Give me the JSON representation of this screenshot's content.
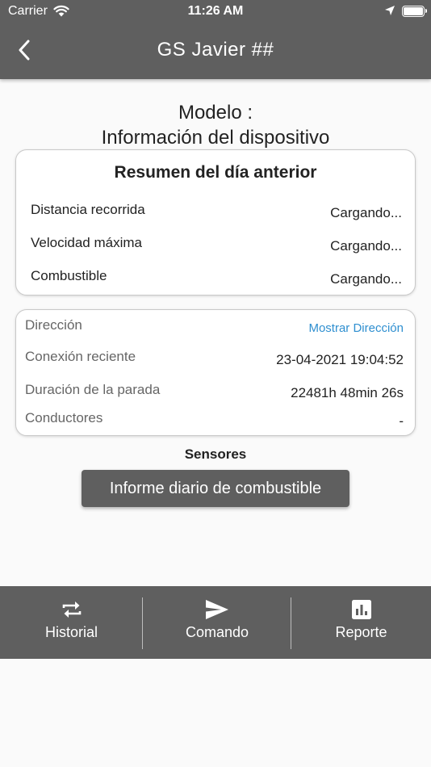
{
  "status_bar": {
    "carrier": "Carrier",
    "time": "11:26 AM"
  },
  "header": {
    "title": "GS Javier ##"
  },
  "model": {
    "line1": "Modelo :",
    "line2": "Información del dispositivo"
  },
  "summary": {
    "title": "Resumen del día anterior",
    "rows": [
      {
        "label": "Distancia recorrida",
        "value": "Cargando..."
      },
      {
        "label": "Velocidad máxima",
        "value": "Cargando..."
      },
      {
        "label": "Combustible",
        "value": "Cargando..."
      }
    ]
  },
  "info": {
    "rows": [
      {
        "label": "Dirección",
        "value": "Mostrar Dirección"
      },
      {
        "label": "Conexión reciente",
        "value": "23-04-2021 19:04:52"
      },
      {
        "label": "Duración de la parada",
        "value": "22481h 48min 26s"
      },
      {
        "label": "Conductores",
        "value": "-"
      }
    ]
  },
  "sensors": {
    "heading": "Sensores",
    "fuel_report_button": "Informe diario de combustible"
  },
  "bottom_nav": {
    "tabs": [
      {
        "label": "Historial",
        "icon": "repeat-icon"
      },
      {
        "label": "Comando",
        "icon": "send-icon"
      },
      {
        "label": "Reporte",
        "icon": "bar-chart-icon"
      }
    ]
  },
  "colors": {
    "bar_background": "#5f5f5f",
    "page_background": "#fafafa",
    "link": "#2f8fd0"
  }
}
